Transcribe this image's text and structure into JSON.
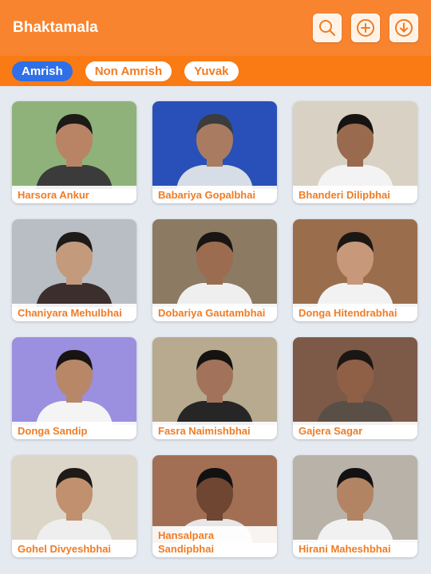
{
  "app": {
    "title": "Bhaktamala",
    "actions": [
      {
        "icon": "search-icon"
      },
      {
        "icon": "add-circle-icon"
      },
      {
        "icon": "download-circle-icon"
      }
    ]
  },
  "tabs": [
    {
      "label": "Amrish",
      "active": true
    },
    {
      "label": "Non Amrish",
      "active": false
    },
    {
      "label": "Yuvak",
      "active": false
    }
  ],
  "colors": {
    "appbar": "#f8842f",
    "tabbar": "#fa7a14",
    "active_tab": "#2f6fe8",
    "accent_text": "#f07c24",
    "background": "#e5e9f0"
  },
  "members": [
    {
      "name": "Harsora Ankur",
      "bg": "#8fb27a",
      "skin": "#b88465",
      "shirt": "#3b3b3b",
      "hair": "#1e1a18"
    },
    {
      "name": "Babariya Gopalbhai",
      "bg": "#2850b8",
      "skin": "#a97c62",
      "shirt": "#d7dde6",
      "hair": "#3c3c3c"
    },
    {
      "name": "Bhanderi Dilipbhai",
      "bg": "#d9d2c4",
      "skin": "#9a6a4e",
      "shirt": "#f3f3f3",
      "hair": "#161412"
    },
    {
      "name": "Chaniyara Mehulbhai",
      "bg": "#b9bec4",
      "skin": "#c39a7c",
      "shirt": "#3d2e2e",
      "hair": "#1d1a18"
    },
    {
      "name": "Dobariya Gautambhai",
      "bg": "#8c7a63",
      "skin": "#9c6c50",
      "shirt": "#efefef",
      "hair": "#181512"
    },
    {
      "name": "Donga Hitendrabhai",
      "bg": "#9a6e4d",
      "skin": "#c8987a",
      "shirt": "#f2f2f2",
      "hair": "#1b1715"
    },
    {
      "name": "Donga Sandip",
      "bg": "#9b8fdf",
      "skin": "#b88768",
      "shirt": "#f4f4f4",
      "hair": "#171412"
    },
    {
      "name": "Fasra Naimishbhai",
      "bg": "#b7aa8e",
      "skin": "#a2735a",
      "shirt": "#262626",
      "hair": "#151210"
    },
    {
      "name": "Gajera Sagar",
      "bg": "#7d5a48",
      "skin": "#8f5f46",
      "shirt": "#5a4f46",
      "hair": "#1a1613"
    },
    {
      "name": "Gohel Divyeshbhai",
      "bg": "#dcd6c8",
      "skin": "#c0906f",
      "shirt": "#eeeeee",
      "hair": "#1f1a17"
    },
    {
      "name": "Hansalpara Sandipbhai",
      "bg": "#a36f54",
      "skin": "#6e4632",
      "shirt": "#e6e6e6",
      "hair": "#111111"
    },
    {
      "name": "Hirani Maheshbhai",
      "bg": "#b8b2a8",
      "skin": "#b28463",
      "shirt": "#f1f1f1",
      "hair": "#121212"
    }
  ]
}
